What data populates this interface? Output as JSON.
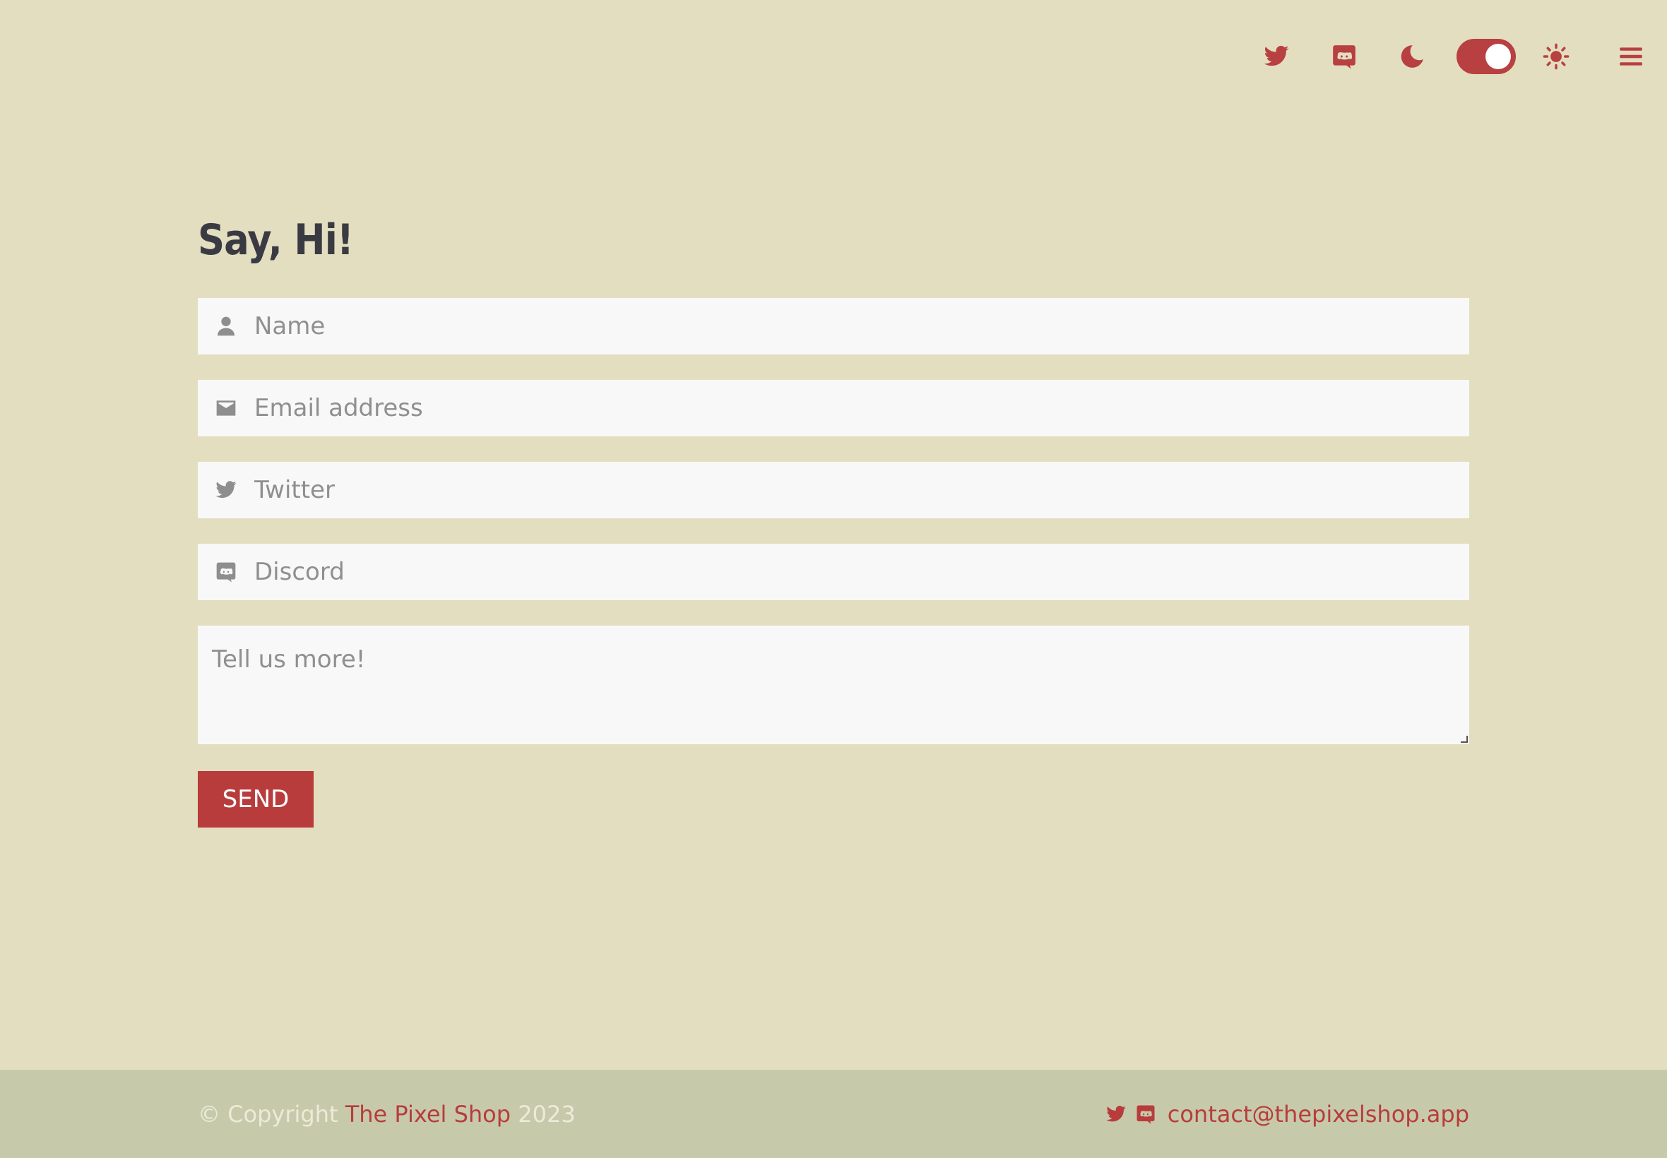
{
  "header": {
    "icons": {
      "twitter": "twitter-icon",
      "discord": "discord-icon",
      "dark_mode": "moon-icon",
      "light_mode": "sun-icon",
      "menu": "hamburger-menu-icon"
    },
    "theme_toggle_on": true
  },
  "form": {
    "title": "Say, Hi!",
    "name_placeholder": "Name",
    "email_placeholder": "Email address",
    "twitter_placeholder": "Twitter",
    "discord_placeholder": "Discord",
    "message_placeholder": "Tell us more!",
    "send_label": "SEND"
  },
  "footer": {
    "copyright_prefix": "© Copyright ",
    "brand": "The Pixel Shop",
    "year": " 2023",
    "contact_email": "contact@thepixelshop.app"
  },
  "colors": {
    "background": "#e3dec0",
    "accent": "#b83c3c",
    "footer_bg": "#c6caaa",
    "title_text": "#3a3a42",
    "input_bg": "#f8f8f8"
  }
}
